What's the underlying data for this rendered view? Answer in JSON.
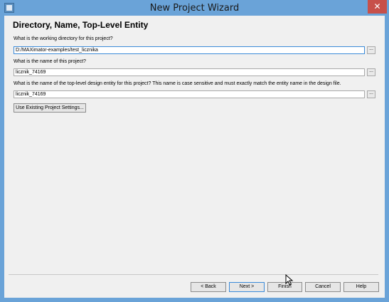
{
  "window": {
    "title": "New Project Wizard",
    "close_label": "✕"
  },
  "page": {
    "title": "Directory, Name, Top-Level Entity",
    "working_dir_label": "What is the working directory for this project?",
    "working_dir_value": "D:/MAXimator-examples/test_licznika",
    "project_name_label": "What is the name of this project?",
    "project_name_value": "licznik_74169",
    "top_entity_label": "What is the name of the top-level design entity for this project? This name is case sensitive and must exactly match the entity name in the design file.",
    "top_entity_value": "licznik_74169",
    "browse_label": "...",
    "use_existing_label": "Use Existing Project Settings..."
  },
  "footer": {
    "back_label": "< Back",
    "next_label": "Next >",
    "finish_label": "Finish",
    "cancel_label": "Cancel",
    "help_label": "Help"
  }
}
